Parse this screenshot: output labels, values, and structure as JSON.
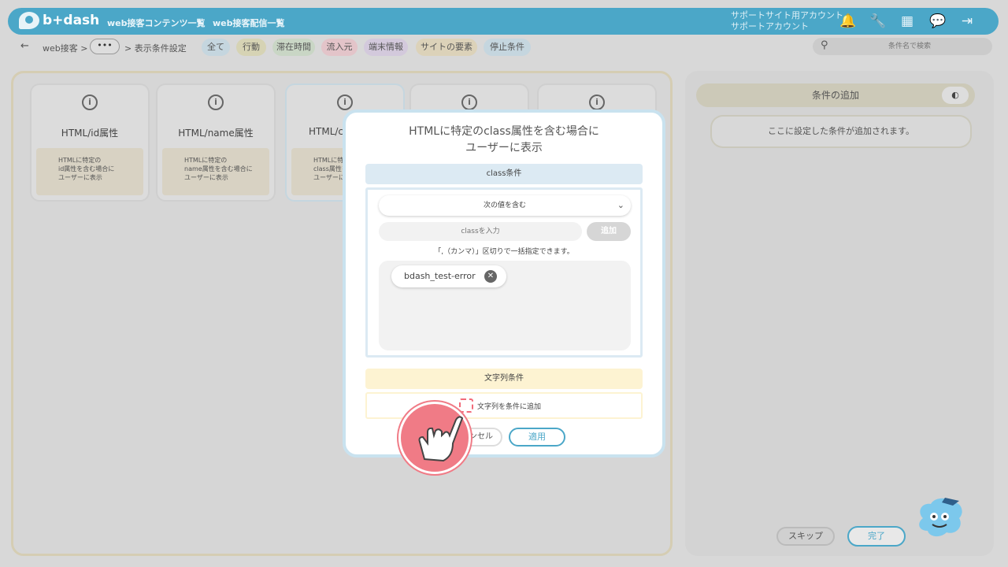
{
  "header": {
    "logo_text": "b+dash",
    "nav": [
      "web接客コンテンツ一覧",
      "web接客配信一覧"
    ],
    "account_line1": "サポートサイト用アカウント",
    "account_line2": "サポートアカウント",
    "icons": [
      "bell-icon",
      "wrench-icon",
      "apps-grid-icon",
      "chat-icon",
      "logout-icon"
    ]
  },
  "breadcrumb": {
    "back": "←",
    "root": "web接客 >",
    "more": "•••",
    "current": "> 表示条件設定",
    "chips": [
      {
        "label": "全て",
        "color": "#c5d6df"
      },
      {
        "label": "行動",
        "color": "#d6d3b4"
      },
      {
        "label": "滞在時間",
        "color": "#c9d6c5"
      },
      {
        "label": "流入元",
        "color": "#e3c4c9"
      },
      {
        "label": "端末情報",
        "color": "#d3c9dc"
      },
      {
        "label": "サイトの要素",
        "color": "#dcd2b9"
      },
      {
        "label": "停止条件",
        "color": "#c5d6df"
      }
    ],
    "search_placeholder": "条件名で検索"
  },
  "cards": [
    {
      "title": "HTML/id属性",
      "desc": [
        "HTMLに特定の",
        "id属性を含む場合に",
        "ユーザーに表示"
      ]
    },
    {
      "title": "HTML/name属性",
      "desc": [
        "HTMLに特定の",
        "name属性を含む場合に",
        "ユーザーに表示"
      ]
    },
    {
      "title": "HTML/c",
      "desc": [
        "HTMLに特定",
        "class属性を",
        "ユーザーに"
      ]
    }
  ],
  "right": {
    "add_title": "条件の追加",
    "placeholder": "ここに設定した条件が追加されます。",
    "skip": "スキップ",
    "done": "完了"
  },
  "modal": {
    "title_line1": "HTMLに特定のclass属性を含む場合に",
    "title_line2": "ユーザーに表示",
    "class_head": "class条件",
    "select_value": "次の値を含む",
    "input_placeholder": "classを入力",
    "add_button": "追加",
    "hint": "「,（カンマ）」区切りで一括指定できます。",
    "tags": [
      "bdash_test-error"
    ],
    "string_head": "文字列条件",
    "checkbox_label": "文字列を条件に追加",
    "cancel": "ンセル",
    "apply": "適用"
  }
}
